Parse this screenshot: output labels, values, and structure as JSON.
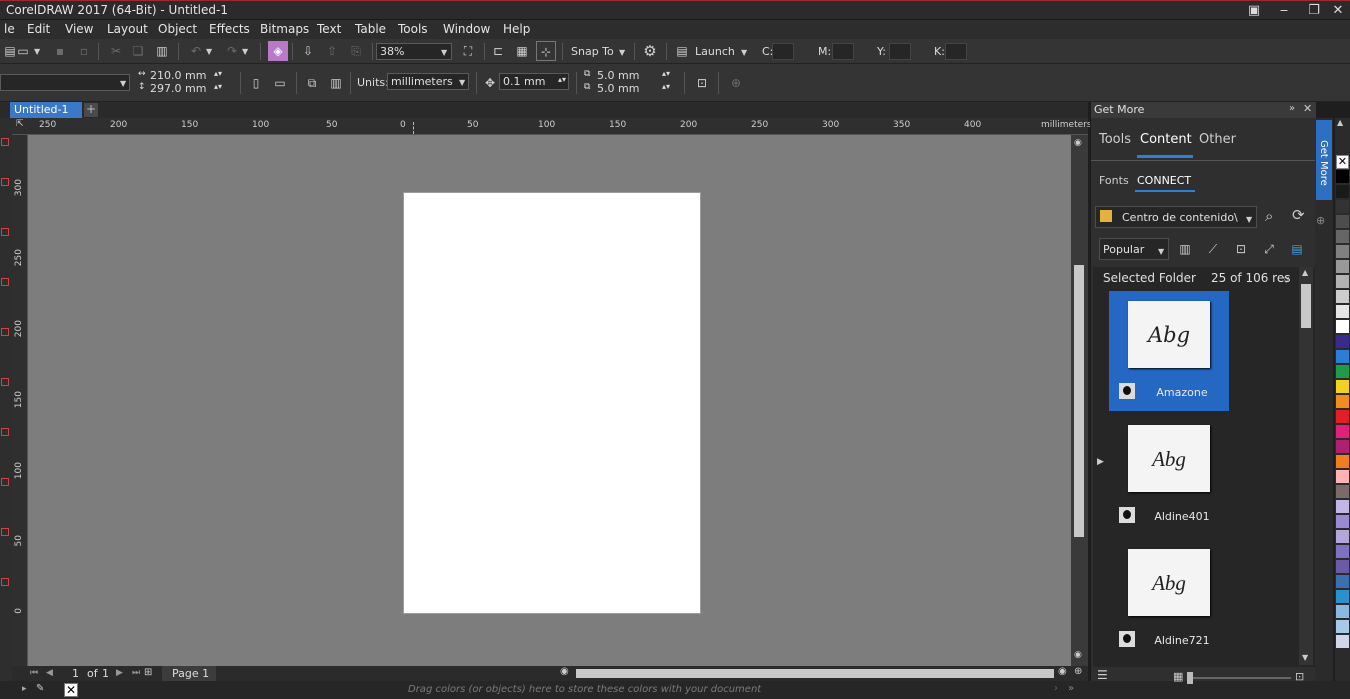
{
  "window": {
    "title": "CorelDRAW 2017 (64-Bit) - Untitled-1",
    "minimize": "‒",
    "restore": "❐",
    "close": "✕"
  },
  "menu": [
    "le",
    "Edit",
    "View",
    "Layout",
    "Object",
    "Effects",
    "Bitmaps",
    "Text",
    "Table",
    "Tools",
    "Window",
    "Help"
  ],
  "standard_toolbar": {
    "zoom": "38%",
    "snap_to": "Snap To",
    "launch": "Launch",
    "c_label": "C:",
    "m_label": "M:",
    "y_label": "Y:",
    "k_label": "K:"
  },
  "property_bar": {
    "width": "210.0 mm",
    "height": "297.0 mm",
    "units_label": "Units:",
    "units": "millimeters",
    "nudge": "0.1 mm",
    "dup_x": "5.0 mm",
    "dup_y": "5.0 mm"
  },
  "document_tab": "Untitled-1",
  "ruler": {
    "h_labels": [
      "250",
      "200",
      "150",
      "100",
      "50",
      "0",
      "50",
      "100",
      "150",
      "200",
      "250",
      "300",
      "350",
      "400"
    ],
    "unit": "millimeters",
    "v_labels": [
      "300",
      "250",
      "200",
      "150",
      "100",
      "50",
      "0"
    ]
  },
  "page_nav": {
    "current": "1",
    "of": "of",
    "total": "1",
    "page_tab": "Page 1"
  },
  "status_hint": "Drag colors (or objects) here to store these colors with your document",
  "docker": {
    "title": "Get More",
    "tabs": [
      "Tools",
      "Content",
      "Other"
    ],
    "active_tab": "Content",
    "subtabs": [
      "Fonts",
      "CONNECT"
    ],
    "folder": "Centro de contenido\\",
    "sort": "Popular",
    "selected_folder_label": "Selected Folder",
    "results": "25 of 106 res",
    "fonts": [
      {
        "name": "Amazone",
        "sample": "Abg",
        "selected": true
      },
      {
        "name": "Aldine401",
        "sample": "Abg",
        "selected": false
      },
      {
        "name": "Aldine721",
        "sample": "Abg",
        "selected": false
      }
    ],
    "side_tab": "Get More"
  },
  "palette_colors": [
    "#ffffff",
    "#000000",
    "#1a1a1a",
    "#333333",
    "#4d4d4d",
    "#666666",
    "#808080",
    "#999999",
    "#b3b3b3",
    "#cccccc",
    "#e6e6e6",
    "#ffffff",
    "#3a2a8c",
    "#2a7fd4",
    "#1f9c4a",
    "#f2d21e",
    "#f28c1e",
    "#e01f26",
    "#e0207a",
    "#b0206e",
    "#f27d1e",
    "#ffb3b3",
    "#7a6a6a",
    "#c2b6e6",
    "#9a8ad4",
    "#b3a6d9",
    "#8070c0",
    "#6a5aa8",
    "#3a6fb0",
    "#2a90d0",
    "#8ab8e0",
    "#a8c8e8",
    "#d0d8e8"
  ]
}
